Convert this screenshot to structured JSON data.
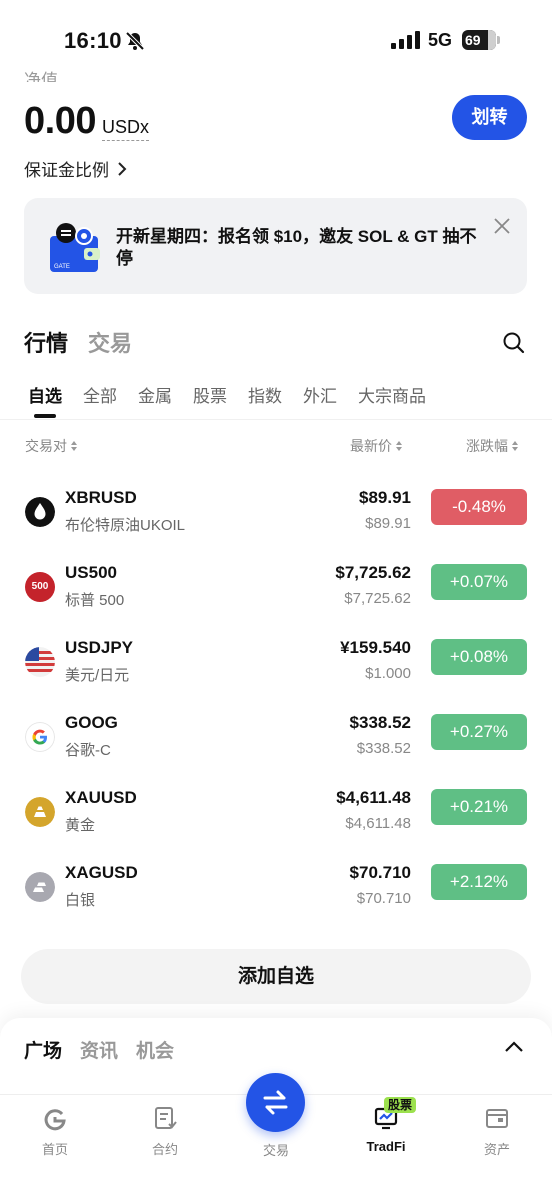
{
  "status_bar": {
    "time": "16:10",
    "network": "5G",
    "battery": "69"
  },
  "account": {
    "net_value_label": "净值",
    "balance": "0.00",
    "unit": "USDx",
    "transfer_label": "划转",
    "margin_ratio_label": "保证金比例"
  },
  "banner": {
    "text": "开新星期四：报名领 $10，邀友 SOL & GT 抽不停",
    "illustration_label": "GATE"
  },
  "section_tabs": [
    "行情",
    "交易"
  ],
  "category_tabs": [
    "自选",
    "全部",
    "金属",
    "股票",
    "指数",
    "外汇",
    "大宗商品"
  ],
  "list_header": {
    "pair": "交易对",
    "last_price": "最新价",
    "change": "涨跌幅"
  },
  "rows": [
    {
      "symbol": "XBRUSD",
      "name": "布伦特原油UKOIL",
      "price": "$89.91",
      "price_sub": "$89.91",
      "change": "-0.48%",
      "direction": "down",
      "icon": "oil-drop-icon",
      "icon_color": "#111111"
    },
    {
      "symbol": "US500",
      "name": "标普 500",
      "price": "$7,725.62",
      "price_sub": "$7,725.62",
      "change": "+0.07%",
      "direction": "up",
      "icon": "sp500-icon",
      "icon_color": "#c4232b",
      "icon_text": "500"
    },
    {
      "symbol": "USDJPY",
      "name": "美元/日元",
      "price": "¥159.540",
      "price_sub": "$1.000",
      "change": "+0.08%",
      "direction": "up",
      "icon": "us-flag-icon",
      "icon_color": "#2b4aa0"
    },
    {
      "symbol": "GOOG",
      "name": "谷歌-C",
      "price": "$338.52",
      "price_sub": "$338.52",
      "change": "+0.27%",
      "direction": "up",
      "icon": "google-icon",
      "icon_color": "#4285f4"
    },
    {
      "symbol": "XAUUSD",
      "name": "黄金",
      "price": "$4,611.48",
      "price_sub": "$4,611.48",
      "change": "+0.21%",
      "direction": "up",
      "icon": "gold-bar-icon",
      "icon_color": "#d4a52c"
    },
    {
      "symbol": "XAGUSD",
      "name": "白银",
      "price": "$70.710",
      "price_sub": "$70.710",
      "change": "+2.12%",
      "direction": "up",
      "icon": "silver-bar-icon",
      "icon_color": "#a8a8b0"
    }
  ],
  "add_watchlist_label": "添加自选",
  "sheet_tabs": [
    "广场",
    "资讯",
    "机会"
  ],
  "bottom_nav": {
    "home": "首页",
    "contract": "合约",
    "trade": "交易",
    "tradfi": "TradFi",
    "tradfi_badge": "股票",
    "assets": "资产"
  },
  "colors": {
    "accent": "#2354e6",
    "up": "#5fbf85",
    "down": "#e05d65"
  }
}
